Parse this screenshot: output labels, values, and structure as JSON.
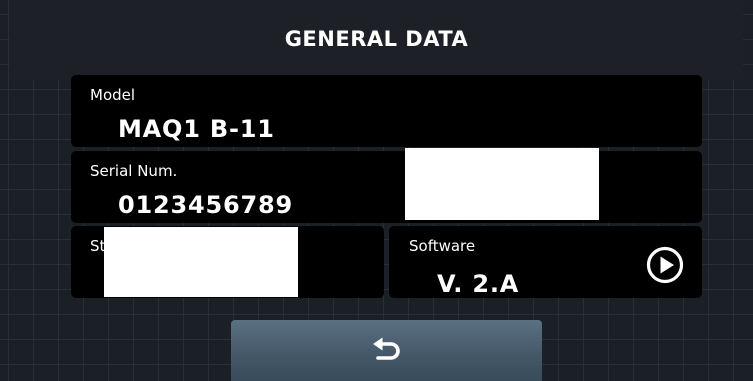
{
  "header": {
    "title": "GENERAL DATA"
  },
  "model": {
    "label": "Model",
    "value": "MAQ1 B-11"
  },
  "serial": {
    "label": "Serial Num.",
    "value": "0123456789"
  },
  "status": {
    "label_fragment": "St"
  },
  "software": {
    "label": "Software",
    "value": "V. 2.A"
  },
  "icons": {
    "play": "play-circle-icon",
    "back": "return-arrow-icon"
  },
  "colors": {
    "background": "#1b2026",
    "panel": "#000000",
    "button": "#4c6070"
  }
}
